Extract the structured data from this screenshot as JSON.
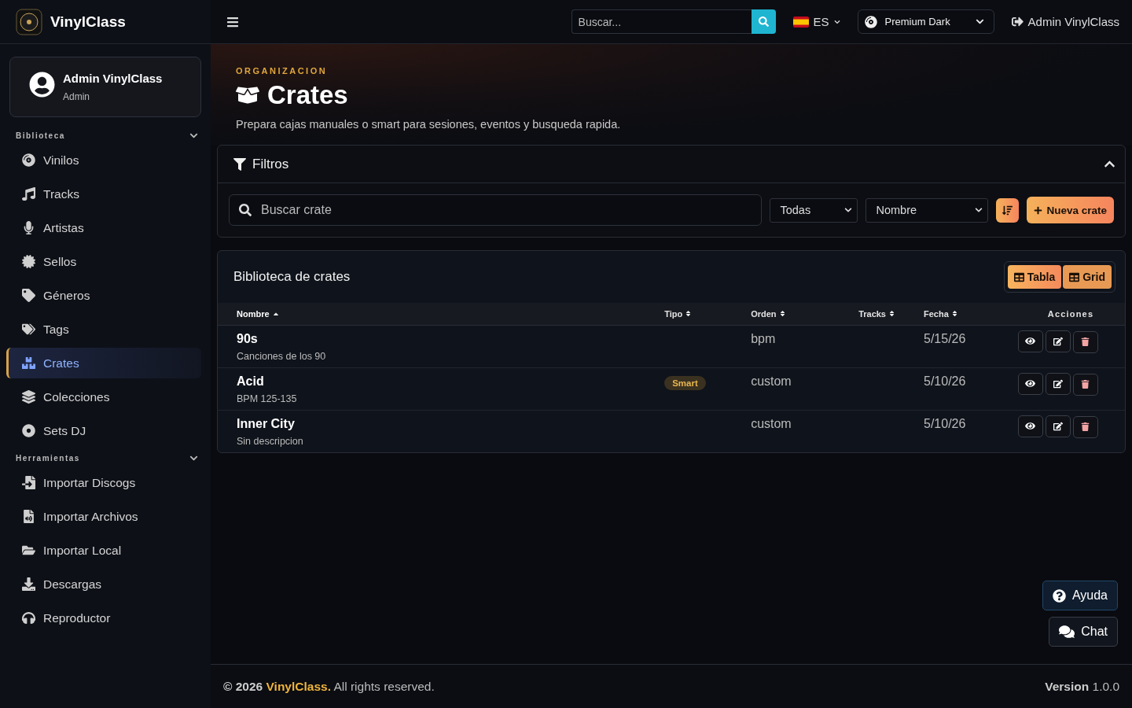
{
  "brand": {
    "name": "VinylClass"
  },
  "topbar": {
    "search_placeholder": "Buscar...",
    "language": "ES",
    "theme": "Premium Dark",
    "user": "Admin VinylClass"
  },
  "profile": {
    "name": "Admin VinylClass",
    "role": "Admin"
  },
  "sidebar": {
    "sections": [
      {
        "title": "Biblioteca",
        "expanded": true,
        "items": [
          {
            "label": "Vinilos",
            "selected": false
          },
          {
            "label": "Tracks",
            "selected": false
          },
          {
            "label": "Artistas",
            "selected": false
          },
          {
            "label": "Sellos",
            "selected": false
          },
          {
            "label": "Géneros",
            "selected": false
          },
          {
            "label": "Tags",
            "selected": false
          },
          {
            "label": "Crates",
            "selected": true
          },
          {
            "label": "Colecciones",
            "selected": false
          },
          {
            "label": "Sets DJ",
            "selected": false
          }
        ]
      },
      {
        "title": "Herramientas",
        "expanded": true,
        "items": [
          {
            "label": "Importar Discogs",
            "selected": false
          },
          {
            "label": "Importar Archivos",
            "selected": false
          },
          {
            "label": "Importar Local",
            "selected": false
          },
          {
            "label": "Descargas",
            "selected": false
          },
          {
            "label": "Reproductor",
            "selected": false
          }
        ]
      }
    ]
  },
  "page": {
    "eyebrow": "ORGANIZACION",
    "title": "Crates",
    "subtitle": "Prepara cajas manuales o smart para sesiones, eventos y busqueda rapida."
  },
  "filters": {
    "title": "Filtros",
    "expanded": true,
    "search_placeholder": "Buscar crate",
    "type_select": "Todas",
    "sort_select": "Nombre",
    "new_button": "Nueva crate"
  },
  "library": {
    "title": "Biblioteca de crates",
    "views": [
      {
        "label": "Tabla",
        "selected": true
      },
      {
        "label": "Grid",
        "selected": false
      }
    ],
    "columns": [
      {
        "label": "Nombre",
        "sortable": true,
        "sorted": true
      },
      {
        "label": "Tipo",
        "sortable": true,
        "sorted": false
      },
      {
        "label": "Orden",
        "sortable": true,
        "sorted": false
      },
      {
        "label": "Tracks",
        "sortable": true,
        "sorted": false
      },
      {
        "label": "Fecha",
        "sortable": true,
        "sorted": false
      },
      {
        "label": "Acciones",
        "sortable": false,
        "sorted": false
      }
    ],
    "rows": [
      {
        "name": "90s",
        "description": "Canciones de los 90",
        "orden": "bpm",
        "fecha": "5/15/26"
      },
      {
        "name": "Acid",
        "description": "BPM 125-135",
        "tipo": "Smart",
        "orden": "custom",
        "fecha": "5/10/26"
      },
      {
        "name": "Inner City",
        "description": "Sin descripcion",
        "orden": "custom",
        "fecha": "5/10/26"
      }
    ]
  },
  "floating": {
    "help": "Ayuda",
    "chat": "Chat"
  },
  "footer": {
    "year": "© 2026",
    "brand": "VinylClass.",
    "rights": "All rights reserved.",
    "version": "**Version** 1.0.0"
  }
}
